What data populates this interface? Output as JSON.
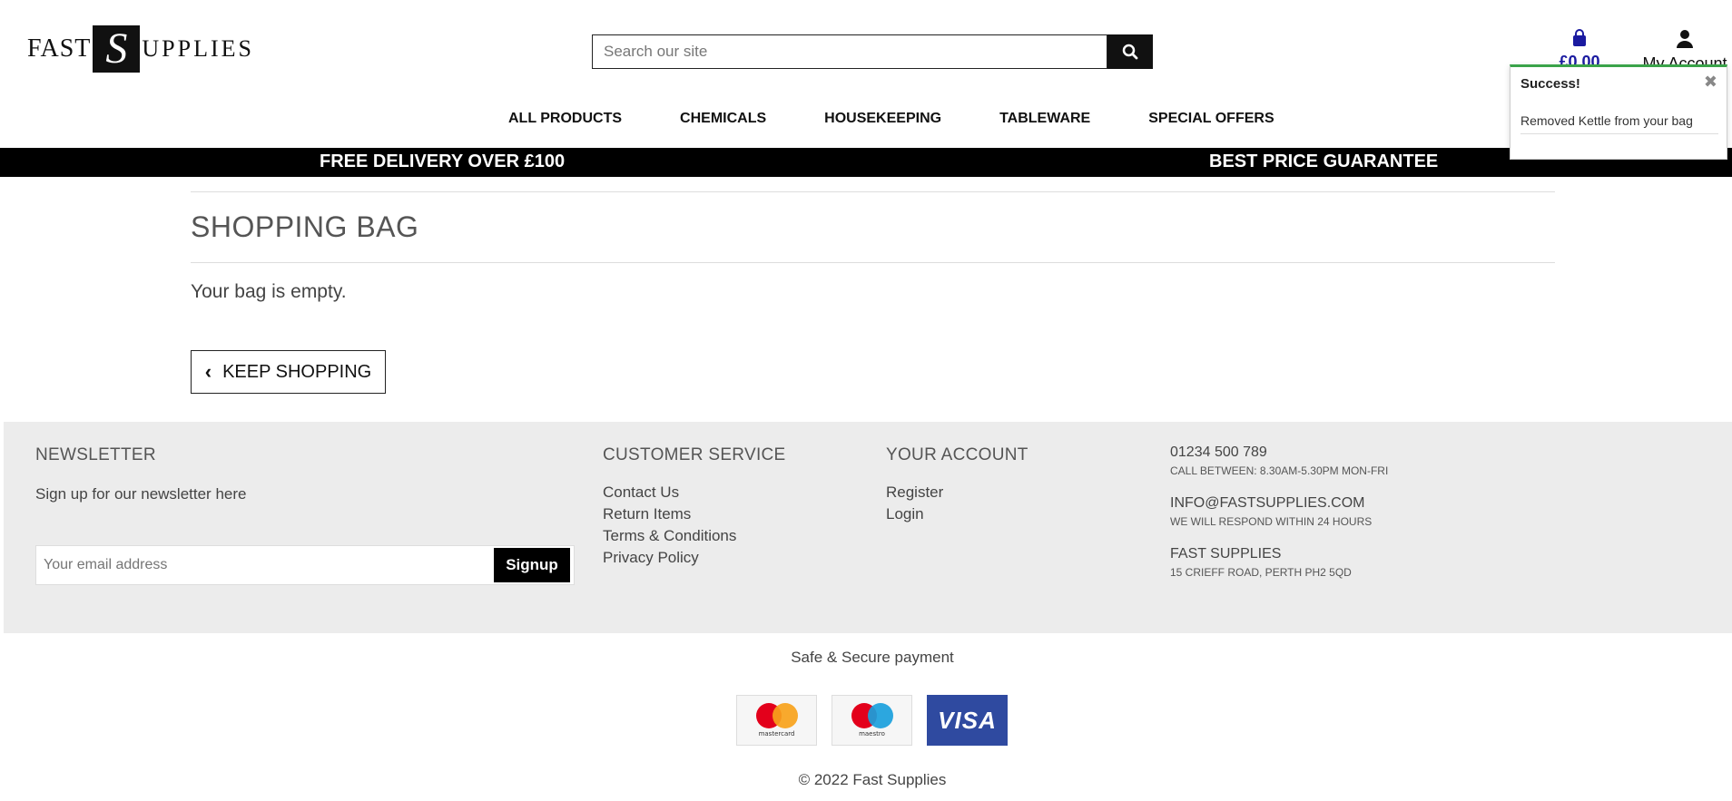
{
  "header": {
    "logo_prefix": "FAST",
    "logo_letter": "S",
    "logo_suffix": "UPPLIES",
    "search_placeholder": "Search our site",
    "bag_total": "£0.00",
    "account_label": "My Account"
  },
  "nav": {
    "items": [
      {
        "label": "ALL PRODUCTS"
      },
      {
        "label": "CHEMICALS"
      },
      {
        "label": "HOUSEKEEPING"
      },
      {
        "label": "TABLEWARE"
      },
      {
        "label": "SPECIAL OFFERS"
      }
    ]
  },
  "banner": {
    "left": "FREE DELIVERY OVER £100",
    "right": "BEST PRICE GUARANTEE"
  },
  "toast": {
    "title": "Success!",
    "close": "✖",
    "message": "Removed Kettle from your bag",
    "accent": "#3aa34a"
  },
  "main": {
    "title": "SHOPPING BAG",
    "empty_text": "Your bag is empty.",
    "keep_shopping": "KEEP SHOPPING"
  },
  "footer": {
    "newsletter": {
      "heading": "NEWSLETTER",
      "subtext": "Sign up for our newsletter here",
      "placeholder": "Your email address",
      "button": "Signup"
    },
    "customer_service": {
      "heading": "CUSTOMER SERVICE",
      "links": [
        "Contact Us",
        "Return Items",
        "Terms & Conditions",
        "Privacy Policy"
      ]
    },
    "your_account": {
      "heading": "YOUR ACCOUNT",
      "links": [
        "Register",
        "Login"
      ]
    },
    "contact": {
      "phone": "01234 500 789",
      "phone_note": "CALL BETWEEN: 8.30AM-5.30PM MON-FRI",
      "email": "INFO@FASTSUPPLIES.COM",
      "email_note": "WE WILL RESPOND WITHIN 24 HOURS",
      "company": "FAST SUPPLIES",
      "address": "15 CRIEFF ROAD, PERTH PH2 5QD"
    }
  },
  "payment": {
    "title": "Safe & Secure payment",
    "cards": [
      "mastercard",
      "maestro",
      "VISA"
    ],
    "copyright": "© 2022 Fast Supplies"
  }
}
